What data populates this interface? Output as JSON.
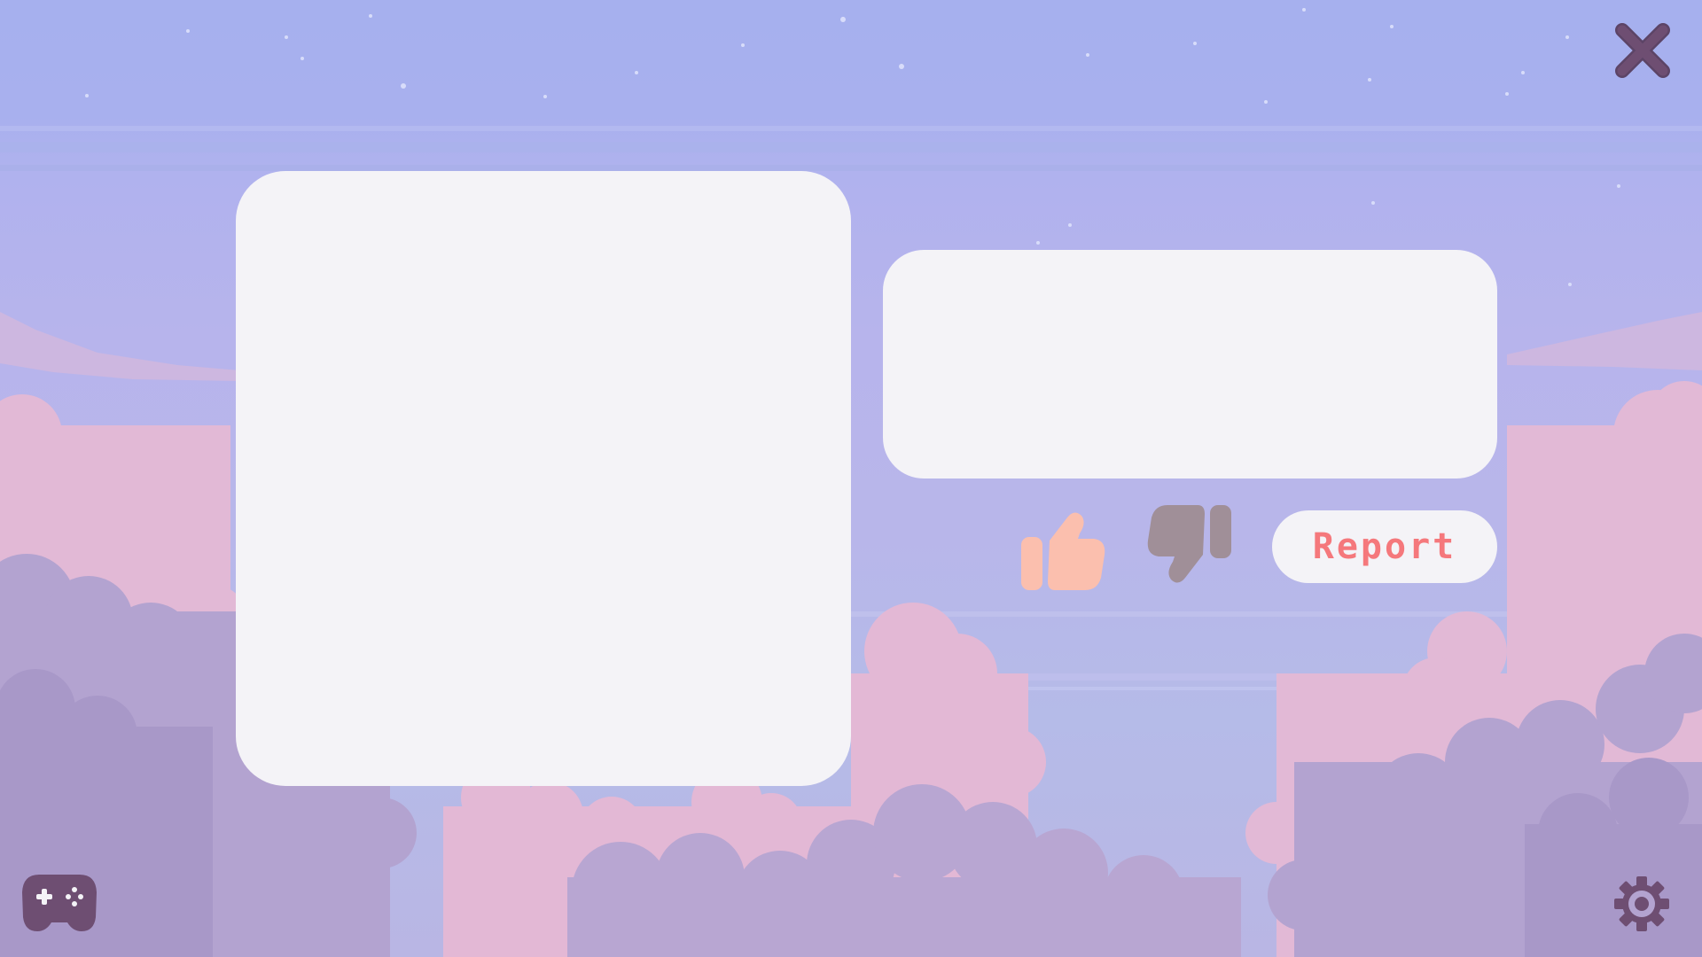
{
  "rating": {
    "report_label": "Report",
    "like_icon": "thumbs-up-icon",
    "dislike_icon": "thumbs-down-icon"
  },
  "controls": {
    "close_icon": "close-icon",
    "games_icon": "gamepad-icon",
    "settings_icon": "gear-icon"
  },
  "colors": {
    "panel": "#f4f3f7",
    "like": "#fbbfae",
    "dislike": "#a08f98",
    "report_text": "#f5787c",
    "icon_dark": "#6e4e72",
    "sky": "#a6b0ee",
    "cloud_pink": "#e3b8d5",
    "cloud_purple": "#b3a2d0"
  }
}
